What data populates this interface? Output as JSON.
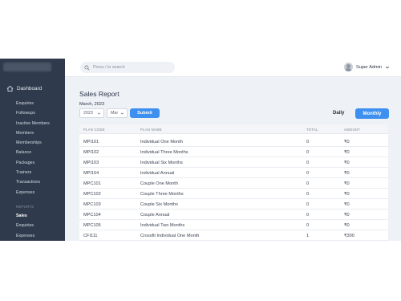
{
  "sidebar": {
    "dashboard_label": "Dashboard",
    "items": [
      {
        "label": "Enquiries"
      },
      {
        "label": "Followups"
      },
      {
        "label": "Inactive Members"
      },
      {
        "label": "Members"
      },
      {
        "label": "Memberships"
      },
      {
        "label": "Balance"
      },
      {
        "label": "Packages"
      },
      {
        "label": "Trainers"
      },
      {
        "label": "Transactions"
      },
      {
        "label": "Expenses"
      }
    ],
    "reports_heading": "REPORTS",
    "report_items": [
      {
        "label": "Sales",
        "active": true
      },
      {
        "label": "Enquiries"
      },
      {
        "label": "Expenses"
      }
    ]
  },
  "topbar": {
    "search_placeholder": "Press / to search",
    "user_name": "Super Admin"
  },
  "main": {
    "title": "Sales Report",
    "month_label": "March, 2023",
    "year_value": "2023",
    "month_value": "Mar",
    "submit_label": "Submit",
    "daily_label": "Daily",
    "monthly_label": "Monthly"
  },
  "table": {
    "headers": [
      "PLAN CODE",
      "PLAN NAME",
      "TOTAL",
      "AMOUNT"
    ],
    "rows": [
      {
        "code": "MPI101",
        "name": "Individual One Month",
        "total": "0",
        "amount": "₹0"
      },
      {
        "code": "MPI102",
        "name": "Individual Three Months",
        "total": "0",
        "amount": "₹0"
      },
      {
        "code": "MPI103",
        "name": "Individual Six Months",
        "total": "0",
        "amount": "₹0"
      },
      {
        "code": "MPI104",
        "name": "Individual Annual",
        "total": "0",
        "amount": "₹0"
      },
      {
        "code": "MPC101",
        "name": "Couple One Month",
        "total": "0",
        "amount": "₹0"
      },
      {
        "code": "MPC102",
        "name": "Couple Three Months",
        "total": "0",
        "amount": "₹0"
      },
      {
        "code": "MPC103",
        "name": "Couple Six Months",
        "total": "0",
        "amount": "₹0"
      },
      {
        "code": "MPC104",
        "name": "Couple Annual",
        "total": "0",
        "amount": "₹0"
      },
      {
        "code": "MPC105",
        "name": "Individual Two Months",
        "total": "0",
        "amount": "₹0"
      },
      {
        "code": "CFI111",
        "name": "Crossfit Individual One Month",
        "total": "1",
        "amount": "₹300"
      }
    ]
  },
  "colors": {
    "sidebar_bg": "#2f3a4c",
    "accent": "#3d8ff0",
    "content_bg": "#eef1f6"
  }
}
